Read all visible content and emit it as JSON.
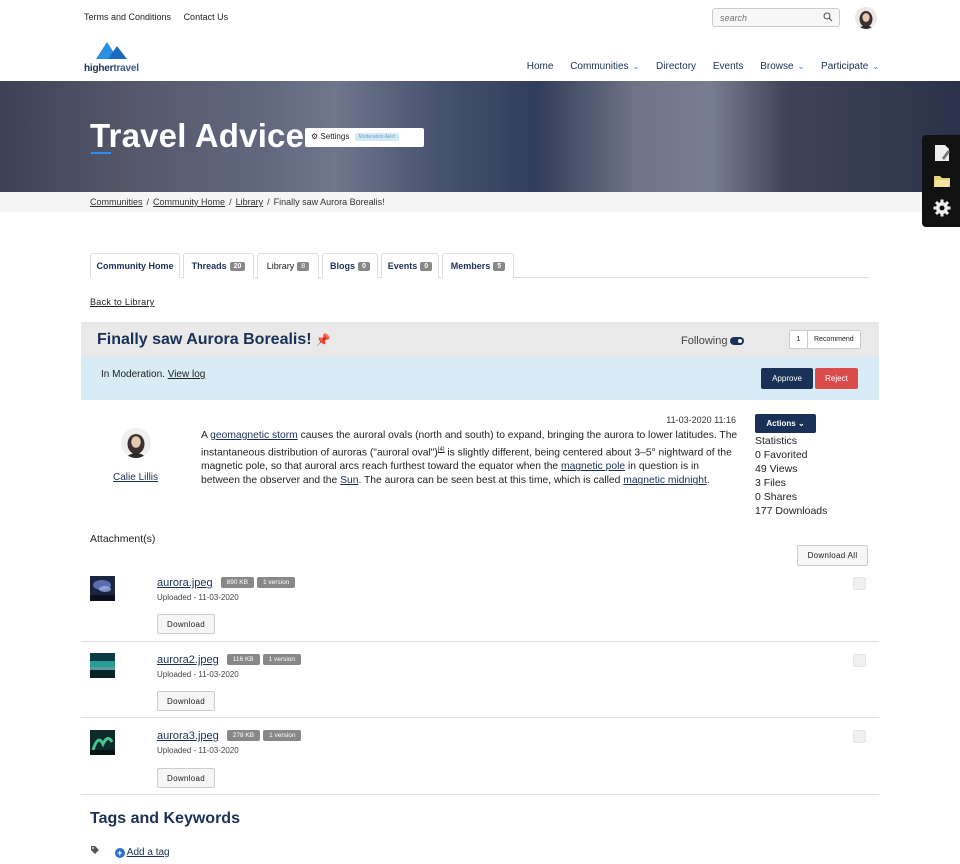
{
  "util": {
    "links": [
      "Terms and Conditions",
      "Contact Us"
    ],
    "search_placeholder": "search"
  },
  "brand": {
    "logo_text_a": "higher",
    "logo_text_b": "travel"
  },
  "nav": {
    "items": [
      {
        "label": "Home",
        "dropdown": false
      },
      {
        "label": "Communities",
        "dropdown": true
      },
      {
        "label": "Directory",
        "dropdown": false
      },
      {
        "label": "Events",
        "dropdown": false
      },
      {
        "label": "Browse",
        "dropdown": true
      },
      {
        "label": "Participate",
        "dropdown": true
      }
    ]
  },
  "hero": {
    "title": "Travel Advice",
    "settings_label": "Settings",
    "moderation_alert": "Moderation Alert"
  },
  "breadcrumb": {
    "items": [
      "Communities",
      "Community Home",
      "Library"
    ],
    "current": "Finally saw Aurora Borealis!"
  },
  "tabs": [
    {
      "label": "Community Home",
      "badge": ""
    },
    {
      "label": "Threads",
      "badge": "20"
    },
    {
      "label": "Library",
      "badge": "8",
      "active": true
    },
    {
      "label": "Blogs",
      "badge": "0"
    },
    {
      "label": "Events",
      "badge": "0"
    },
    {
      "label": "Members",
      "badge": "5"
    }
  ],
  "back_link": "Back to Library",
  "post": {
    "title": "Finally saw Aurora Borealis!",
    "following_label": "Following",
    "recommend_count": "1",
    "recommend_label": "Recommend",
    "moderation_text": "In Moderation.",
    "view_log": "View log",
    "approve": "Approve",
    "reject": "Reject",
    "date": "11-03-2020 11:16",
    "author": "Calie Lillis",
    "body": {
      "t1": "A ",
      "l1": "geomagnetic storm",
      "t2": " causes the auroral ovals (north and south) to expand, bringing the aurora to lower latitudes. The instantaneous distribution of auroras (\"auroral oval\")",
      "ref": "[4]",
      "t3": " is slightly different, being centered about 3–5° nightward of the magnetic pole, so that auroral arcs reach furthest toward the equator when the ",
      "l2": "magnetic pole",
      "t4": " in question is in between the observer and the ",
      "l3": "Sun",
      "t5": ". The aurora can be seen best at this time, which is called ",
      "l4": "magnetic midnight",
      "t6": "."
    },
    "actions_label": "Actions",
    "stats": {
      "heading": "Statistics",
      "favorited": "0 Favorited",
      "views": "49 Views",
      "files": "3 Files",
      "shares": "0 Shares",
      "downloads": "177 Downloads"
    }
  },
  "attachments": {
    "title": "Attachment(s)",
    "download_all": "Download All",
    "files": [
      {
        "name": "aurora.jpeg",
        "size": "890 KB",
        "version": "1 version",
        "uploaded": "Uploaded - 11-03-2020",
        "download": "Download"
      },
      {
        "name": "aurora2.jpeg",
        "size": "116 KB",
        "version": "1 version",
        "uploaded": "Uploaded - 11-03-2020",
        "download": "Download"
      },
      {
        "name": "aurora3.jpeg",
        "size": "278 KB",
        "version": "1 version",
        "uploaded": "Uploaded - 11-03-2020",
        "download": "Download"
      }
    ]
  },
  "tags": {
    "title": "Tags and Keywords",
    "add_tag": "Add a tag"
  },
  "colors": {
    "primary": "#1a3157",
    "accent": "#2a7bd4",
    "danger": "#dc4b4b",
    "moderation_bg": "#d8ecf6"
  }
}
